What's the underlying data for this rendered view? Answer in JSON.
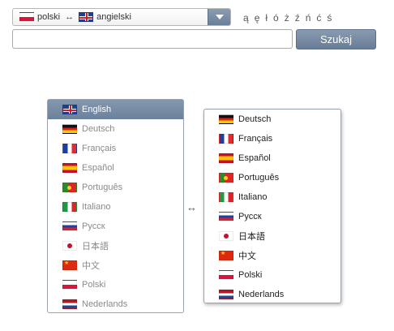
{
  "language_selector": {
    "from_label": "polski",
    "to_label": "angielski",
    "arrow": "↔",
    "from_flag": "flag-pl",
    "to_flag": "flag-en"
  },
  "special_chars": [
    "ą",
    "ę",
    "ł",
    "ó",
    "ż",
    "ź",
    "ń",
    "ć",
    "ś"
  ],
  "search": {
    "value": "",
    "placeholder": "",
    "button_label": "Szukaj"
  },
  "source_languages": [
    {
      "label": "English",
      "flag": "flag-en",
      "selected": true
    },
    {
      "label": "Deutsch",
      "flag": "flag-de"
    },
    {
      "label": "Français",
      "flag": "flag-fr"
    },
    {
      "label": "Español",
      "flag": "flag-es"
    },
    {
      "label": "Português",
      "flag": "flag-pt"
    },
    {
      "label": "Italiano",
      "flag": "flag-it"
    },
    {
      "label": "Русск",
      "flag": "flag-ru"
    },
    {
      "label": "日本語",
      "flag": "flag-jp"
    },
    {
      "label": "中文",
      "flag": "flag-cn"
    },
    {
      "label": "Polski",
      "flag": "flag-pl"
    },
    {
      "label": "Nederlands",
      "flag": "flag-nl"
    }
  ],
  "swap_symbol": "↔",
  "target_languages": [
    {
      "label": "Deutsch",
      "flag": "flag-de"
    },
    {
      "label": "Français",
      "flag": "flag-fr"
    },
    {
      "label": "Español",
      "flag": "flag-es"
    },
    {
      "label": "Português",
      "flag": "flag-pt"
    },
    {
      "label": "Italiano",
      "flag": "flag-it"
    },
    {
      "label": "Русск",
      "flag": "flag-ru"
    },
    {
      "label": "日本語",
      "flag": "flag-jp"
    },
    {
      "label": "中文",
      "flag": "flag-cn"
    },
    {
      "label": "Polski",
      "flag": "flag-pl"
    },
    {
      "label": "Nederlands",
      "flag": "flag-nl"
    }
  ],
  "colors": {
    "accent": "#768aa3",
    "selected_text": "#ffffff",
    "muted_text": "#8a8a8a"
  }
}
